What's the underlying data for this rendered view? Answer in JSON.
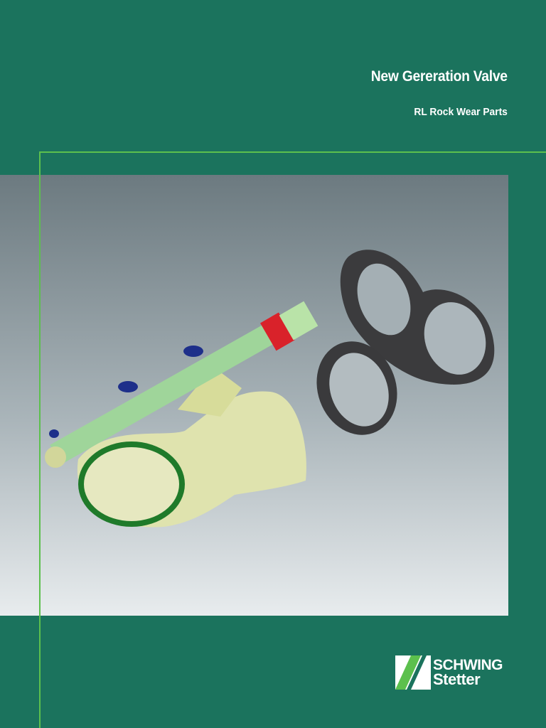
{
  "header": {
    "title": "New Gereration Valve",
    "subtitle": "RL Rock Wear Parts"
  },
  "logo": {
    "line1": "SCHWING",
    "line2": "Stetter"
  },
  "colors": {
    "background": "#1b735d",
    "accent_line": "#5cc04d"
  }
}
